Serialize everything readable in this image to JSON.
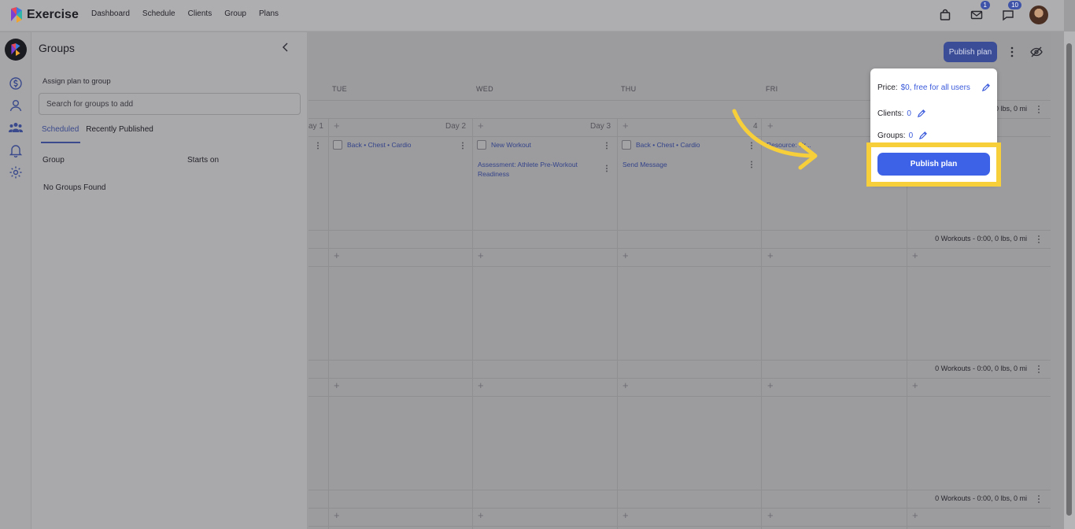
{
  "app": {
    "brand": "Exercise",
    "nav": [
      "Dashboard",
      "Schedule",
      "Clients",
      "Group",
      "Plans"
    ],
    "mail_badge": "1",
    "chat_badge": "10"
  },
  "panel": {
    "title": "Groups",
    "assign_label": "Assign plan to group",
    "search_placeholder": "Search for groups to add",
    "tab_scheduled": "Scheduled",
    "tab_recent": "Recently Published",
    "col_group": "Group",
    "col_starts": "Starts on",
    "empty": "No Groups Found"
  },
  "main": {
    "publish_top": "Publish plan",
    "days": [
      "TUE",
      "WED",
      "THU",
      "FRI"
    ],
    "day_labels": [
      "ay 1",
      "Day 2",
      "Day 3",
      "4"
    ],
    "week1_summary": "0 lbs, 0 mi",
    "summary": "0 Workouts - 0:00, 0 lbs, 0 mi",
    "cards": {
      "tue": "Back • Chest • Cardio",
      "wed": "New Workout",
      "wed_assessment": "Assessment: Athlete Pre-Workout Readiness",
      "thu": "Back • Chest • Cardio",
      "thu_message": "Send Message",
      "fri": "Resource: Cr..."
    }
  },
  "popover": {
    "price_label": "Price:",
    "price_value": "$0, free for all users",
    "clients_label": "Clients:",
    "clients_value": "0",
    "groups_label": "Groups:",
    "groups_value": "0",
    "publish_button": "Publish plan"
  },
  "colors": {
    "accent": "#3d62e8",
    "highlight": "#f7cf3a"
  }
}
